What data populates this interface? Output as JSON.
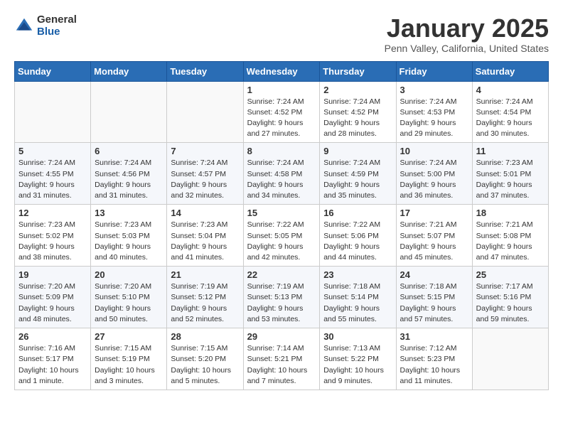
{
  "header": {
    "logo_general": "General",
    "logo_blue": "Blue",
    "month_title": "January 2025",
    "location": "Penn Valley, California, United States"
  },
  "days_of_week": [
    "Sunday",
    "Monday",
    "Tuesday",
    "Wednesday",
    "Thursday",
    "Friday",
    "Saturday"
  ],
  "weeks": [
    [
      {
        "day": "",
        "content": ""
      },
      {
        "day": "",
        "content": ""
      },
      {
        "day": "",
        "content": ""
      },
      {
        "day": "1",
        "content": "Sunrise: 7:24 AM\nSunset: 4:52 PM\nDaylight: 9 hours and 27 minutes."
      },
      {
        "day": "2",
        "content": "Sunrise: 7:24 AM\nSunset: 4:52 PM\nDaylight: 9 hours and 28 minutes."
      },
      {
        "day": "3",
        "content": "Sunrise: 7:24 AM\nSunset: 4:53 PM\nDaylight: 9 hours and 29 minutes."
      },
      {
        "day": "4",
        "content": "Sunrise: 7:24 AM\nSunset: 4:54 PM\nDaylight: 9 hours and 30 minutes."
      }
    ],
    [
      {
        "day": "5",
        "content": "Sunrise: 7:24 AM\nSunset: 4:55 PM\nDaylight: 9 hours and 31 minutes."
      },
      {
        "day": "6",
        "content": "Sunrise: 7:24 AM\nSunset: 4:56 PM\nDaylight: 9 hours and 31 minutes."
      },
      {
        "day": "7",
        "content": "Sunrise: 7:24 AM\nSunset: 4:57 PM\nDaylight: 9 hours and 32 minutes."
      },
      {
        "day": "8",
        "content": "Sunrise: 7:24 AM\nSunset: 4:58 PM\nDaylight: 9 hours and 34 minutes."
      },
      {
        "day": "9",
        "content": "Sunrise: 7:24 AM\nSunset: 4:59 PM\nDaylight: 9 hours and 35 minutes."
      },
      {
        "day": "10",
        "content": "Sunrise: 7:24 AM\nSunset: 5:00 PM\nDaylight: 9 hours and 36 minutes."
      },
      {
        "day": "11",
        "content": "Sunrise: 7:23 AM\nSunset: 5:01 PM\nDaylight: 9 hours and 37 minutes."
      }
    ],
    [
      {
        "day": "12",
        "content": "Sunrise: 7:23 AM\nSunset: 5:02 PM\nDaylight: 9 hours and 38 minutes."
      },
      {
        "day": "13",
        "content": "Sunrise: 7:23 AM\nSunset: 5:03 PM\nDaylight: 9 hours and 40 minutes."
      },
      {
        "day": "14",
        "content": "Sunrise: 7:23 AM\nSunset: 5:04 PM\nDaylight: 9 hours and 41 minutes."
      },
      {
        "day": "15",
        "content": "Sunrise: 7:22 AM\nSunset: 5:05 PM\nDaylight: 9 hours and 42 minutes."
      },
      {
        "day": "16",
        "content": "Sunrise: 7:22 AM\nSunset: 5:06 PM\nDaylight: 9 hours and 44 minutes."
      },
      {
        "day": "17",
        "content": "Sunrise: 7:21 AM\nSunset: 5:07 PM\nDaylight: 9 hours and 45 minutes."
      },
      {
        "day": "18",
        "content": "Sunrise: 7:21 AM\nSunset: 5:08 PM\nDaylight: 9 hours and 47 minutes."
      }
    ],
    [
      {
        "day": "19",
        "content": "Sunrise: 7:20 AM\nSunset: 5:09 PM\nDaylight: 9 hours and 48 minutes."
      },
      {
        "day": "20",
        "content": "Sunrise: 7:20 AM\nSunset: 5:10 PM\nDaylight: 9 hours and 50 minutes."
      },
      {
        "day": "21",
        "content": "Sunrise: 7:19 AM\nSunset: 5:12 PM\nDaylight: 9 hours and 52 minutes."
      },
      {
        "day": "22",
        "content": "Sunrise: 7:19 AM\nSunset: 5:13 PM\nDaylight: 9 hours and 53 minutes."
      },
      {
        "day": "23",
        "content": "Sunrise: 7:18 AM\nSunset: 5:14 PM\nDaylight: 9 hours and 55 minutes."
      },
      {
        "day": "24",
        "content": "Sunrise: 7:18 AM\nSunset: 5:15 PM\nDaylight: 9 hours and 57 minutes."
      },
      {
        "day": "25",
        "content": "Sunrise: 7:17 AM\nSunset: 5:16 PM\nDaylight: 9 hours and 59 minutes."
      }
    ],
    [
      {
        "day": "26",
        "content": "Sunrise: 7:16 AM\nSunset: 5:17 PM\nDaylight: 10 hours and 1 minute."
      },
      {
        "day": "27",
        "content": "Sunrise: 7:15 AM\nSunset: 5:19 PM\nDaylight: 10 hours and 3 minutes."
      },
      {
        "day": "28",
        "content": "Sunrise: 7:15 AM\nSunset: 5:20 PM\nDaylight: 10 hours and 5 minutes."
      },
      {
        "day": "29",
        "content": "Sunrise: 7:14 AM\nSunset: 5:21 PM\nDaylight: 10 hours and 7 minutes."
      },
      {
        "day": "30",
        "content": "Sunrise: 7:13 AM\nSunset: 5:22 PM\nDaylight: 10 hours and 9 minutes."
      },
      {
        "day": "31",
        "content": "Sunrise: 7:12 AM\nSunset: 5:23 PM\nDaylight: 10 hours and 11 minutes."
      },
      {
        "day": "",
        "content": ""
      }
    ]
  ]
}
